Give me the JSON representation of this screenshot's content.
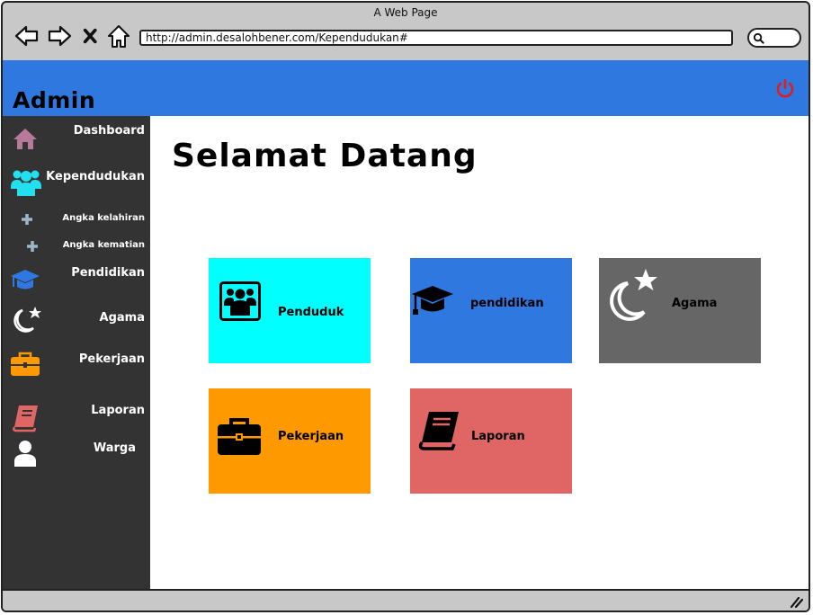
{
  "window": {
    "title": "A Web Page"
  },
  "browser": {
    "url": "http://admin.desalohbener.com/Kependudukan#",
    "back_icon": "arrow-left-icon",
    "forward_icon": "arrow-right-icon",
    "stop_icon": "close-icon",
    "home_icon": "home-icon",
    "search_icon": "search-icon"
  },
  "header": {
    "brand": "Admin",
    "logout_icon": "power-icon",
    "bg": "#2f78e0",
    "logout_color": "#dd1f1f"
  },
  "sidebar": {
    "bg": "#333333",
    "items": [
      {
        "label": "Dashboard",
        "icon": "home-icon",
        "color": "#b87a9c"
      },
      {
        "label": "Kependudukan",
        "icon": "users-icon",
        "color": "#22e0f0"
      },
      {
        "label": "Angka kelahiran",
        "icon": "plus-icon",
        "color": "#9ab8c8"
      },
      {
        "label": "Angka kematian",
        "icon": "plus-icon",
        "color": "#9ab8c8"
      },
      {
        "label": "Pendidikan",
        "icon": "graduation-cap-icon",
        "color": "#2f78e0"
      },
      {
        "label": "Agama",
        "icon": "moon-star-icon",
        "color": "#ffffff"
      },
      {
        "label": "Pekerjaan",
        "icon": "briefcase-icon",
        "color": "#ff9900"
      },
      {
        "label": "Laporan",
        "icon": "book-icon",
        "color": "#e06666"
      },
      {
        "label": "Warga",
        "icon": "user-icon",
        "color": "#ffffff"
      }
    ]
  },
  "main": {
    "title": "Selamat Datang",
    "tiles": [
      {
        "label": "Penduduk",
        "icon": "users-icon",
        "color": "#00ffff"
      },
      {
        "label": "pendidikan",
        "icon": "graduation-cap-icon",
        "color": "#2f78e0"
      },
      {
        "label": "Agama",
        "icon": "moon-star-icon",
        "color": "#666666"
      },
      {
        "label": "Pekerjaan",
        "icon": "briefcase-icon",
        "color": "#ff9900"
      },
      {
        "label": "Laporan",
        "icon": "book-icon",
        "color": "#e06666"
      }
    ]
  }
}
